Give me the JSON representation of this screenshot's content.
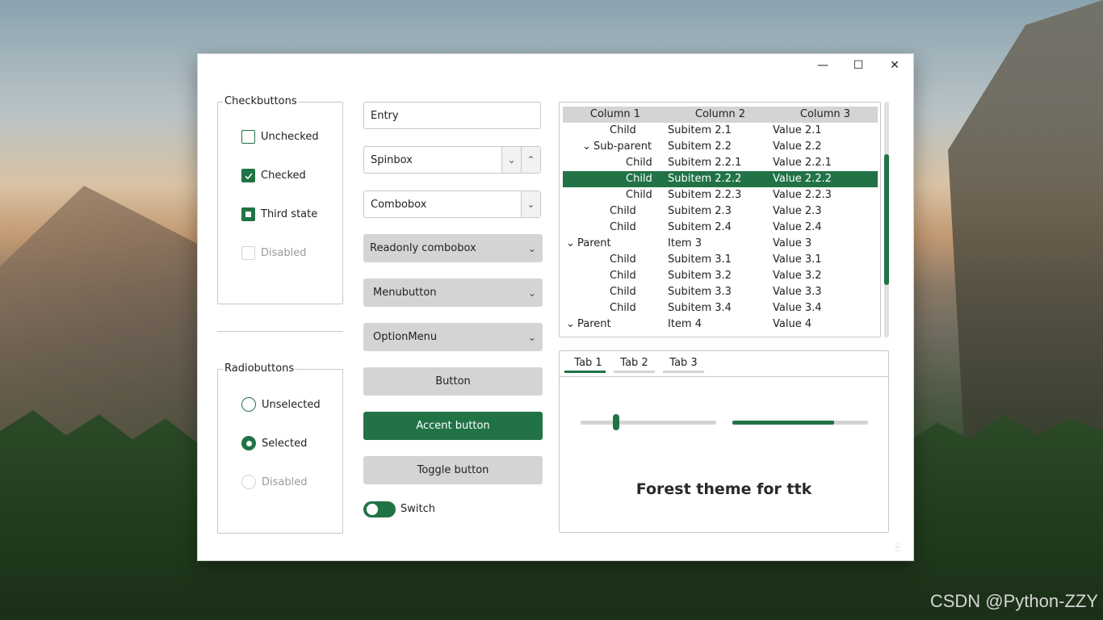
{
  "window": {
    "controls": {
      "minimize": "—",
      "maximize": "☐",
      "close": "✕"
    }
  },
  "checkbuttons": {
    "title": "Checkbuttons",
    "items": [
      {
        "label": "Unchecked",
        "state": "unchecked"
      },
      {
        "label": "Checked",
        "state": "checked"
      },
      {
        "label": "Third state",
        "state": "indeterminate"
      },
      {
        "label": "Disabled",
        "state": "disabled"
      }
    ]
  },
  "radiobuttons": {
    "title": "Radiobuttons",
    "items": [
      {
        "label": "Unselected",
        "state": "unselected"
      },
      {
        "label": "Selected",
        "state": "selected"
      },
      {
        "label": "Disabled",
        "state": "disabled"
      }
    ]
  },
  "inputs": {
    "entry": "Entry",
    "spinbox": "Spinbox",
    "combobox": "Combobox",
    "readonly_combobox": "Readonly combobox",
    "menubutton": "Menubutton",
    "optionmenu": "OptionMenu",
    "button": "Button",
    "accent_button": "Accent button",
    "toggle_button": "Toggle button",
    "switch": "Switch",
    "switch_on": true
  },
  "tree": {
    "columns": [
      "Column 1",
      "Column 2",
      "Column 3"
    ],
    "rows": [
      {
        "c1": "Child",
        "c2": "Subitem 2.1",
        "c3": "Value 2.1",
        "indent": 2,
        "expander": ""
      },
      {
        "c1": "Sub-parent",
        "c2": "Subitem 2.2",
        "c3": "Value 2.2",
        "indent": 1,
        "expander": "⌄"
      },
      {
        "c1": "Child",
        "c2": "Subitem 2.2.1",
        "c3": "Value 2.2.1",
        "indent": 3,
        "expander": ""
      },
      {
        "c1": "Child",
        "c2": "Subitem 2.2.2",
        "c3": "Value 2.2.2",
        "indent": 3,
        "expander": "",
        "selected": true
      },
      {
        "c1": "Child",
        "c2": "Subitem 2.2.3",
        "c3": "Value 2.2.3",
        "indent": 3,
        "expander": ""
      },
      {
        "c1": "Child",
        "c2": "Subitem 2.3",
        "c3": "Value 2.3",
        "indent": 2,
        "expander": ""
      },
      {
        "c1": "Child",
        "c2": "Subitem 2.4",
        "c3": "Value 2.4",
        "indent": 2,
        "expander": ""
      },
      {
        "c1": "Parent",
        "c2": "Item 3",
        "c3": "Value 3",
        "indent": 0,
        "expander": "⌄"
      },
      {
        "c1": "Child",
        "c2": "Subitem 3.1",
        "c3": "Value 3.1",
        "indent": 2,
        "expander": ""
      },
      {
        "c1": "Child",
        "c2": "Subitem 3.2",
        "c3": "Value 3.2",
        "indent": 2,
        "expander": ""
      },
      {
        "c1": "Child",
        "c2": "Subitem 3.3",
        "c3": "Value 3.3",
        "indent": 2,
        "expander": ""
      },
      {
        "c1": "Child",
        "c2": "Subitem 3.4",
        "c3": "Value 3.4",
        "indent": 2,
        "expander": ""
      },
      {
        "c1": "Parent",
        "c2": "Item 4",
        "c3": "Value 4",
        "indent": 0,
        "expander": "⌄"
      }
    ]
  },
  "notebook": {
    "tabs": [
      "Tab 1",
      "Tab 2",
      "Tab 3"
    ],
    "active_tab": 0,
    "scale_value": 0.26,
    "progress_value": 0.75,
    "label": "Forest theme for ttk"
  },
  "accent_color": "#217346",
  "watermark": "CSDN @Python-ZZY"
}
